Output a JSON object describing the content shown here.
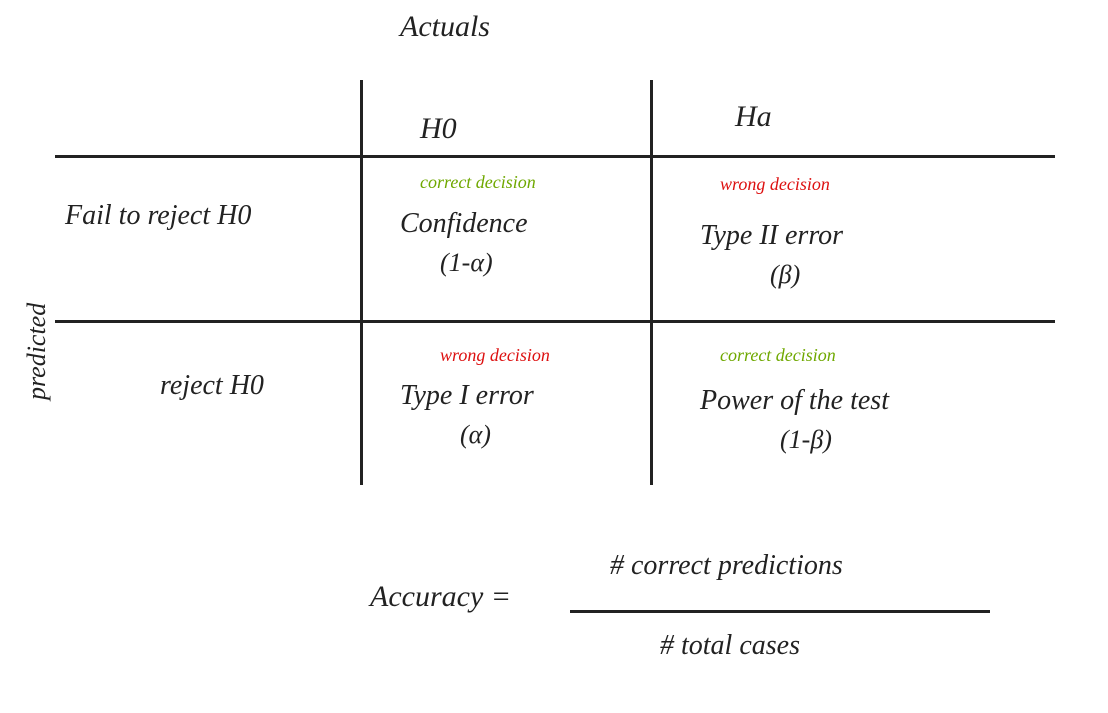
{
  "header": {
    "actuals": "Actuals",
    "predicted": "predicted"
  },
  "columns": {
    "h0": "H0",
    "ha": "Ha"
  },
  "rows": {
    "fail": "Fail to reject H0",
    "reject": "reject H0"
  },
  "notes": {
    "correct": "correct decision",
    "wrong": "wrong decision"
  },
  "cells": {
    "tl": {
      "title": "Confidence",
      "value": "(1-α)"
    },
    "tr": {
      "title": "Type II error",
      "value": "(β)"
    },
    "bl": {
      "title": "Type I error",
      "value": "(α)"
    },
    "br": {
      "title": "Power of the test",
      "value": "(1-β)"
    }
  },
  "formula": {
    "label": "Accuracy =",
    "numerator": "# correct predictions",
    "denominator": "# total cases"
  },
  "chart_data": {
    "type": "table",
    "title": "Hypothesis testing decision matrix",
    "row_label": "predicted",
    "col_label": "Actuals",
    "columns": [
      "H0",
      "Ha"
    ],
    "rows": [
      "Fail to reject H0",
      "reject H0"
    ],
    "cells": [
      [
        "Confidence (1-α) — correct decision",
        "Type II error (β) — wrong decision"
      ],
      [
        "Type I error (α) — wrong decision",
        "Power of the test (1-β) — correct decision"
      ]
    ],
    "formula": "Accuracy = # correct predictions / # total cases"
  }
}
